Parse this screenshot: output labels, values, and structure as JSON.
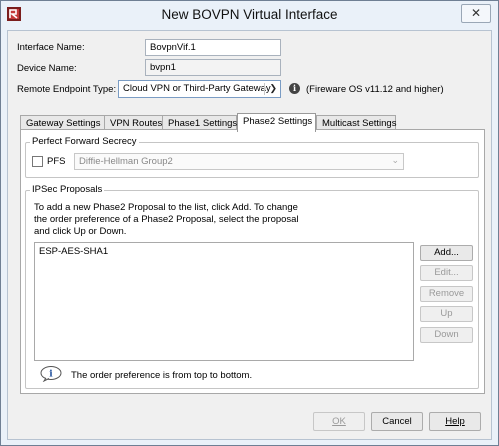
{
  "window": {
    "title": "New BOVPN Virtual Interface",
    "close_glyph": "✕"
  },
  "form": {
    "interface_name_label": "Interface Name:",
    "interface_name_value": "BovpnVif.1",
    "device_name_label": "Device Name:",
    "device_name_value": "bvpn1",
    "remote_endpoint_label": "Remote Endpoint Type:",
    "remote_endpoint_value": "Cloud VPN or Third-Party Gateway",
    "remote_endpoint_note": "(Fireware OS v11.12 and higher)"
  },
  "tabs": [
    {
      "label": "Gateway Settings"
    },
    {
      "label": "VPN Routes"
    },
    {
      "label": "Phase1 Settings"
    },
    {
      "label": "Phase2 Settings"
    },
    {
      "label": "Multicast Settings"
    }
  ],
  "pfs": {
    "group_label": "Perfect Forward Secrecy",
    "checkbox_label": "PFS",
    "checked": false,
    "dh_group_value": "Diffie-Hellman Group2"
  },
  "ipsec": {
    "group_label": "IPSec Proposals",
    "instructions_line1": "To add a new Phase2 Proposal to the list, click Add. To change",
    "instructions_line2": "the order preference of a Phase2 Proposal, select the proposal",
    "instructions_line3": "and click Up or Down.",
    "proposals": [
      "ESP-AES-SHA1"
    ],
    "buttons": {
      "add": "Add...",
      "edit": "Edit...",
      "remove": "Remove",
      "up": "Up",
      "down": "Down"
    },
    "note": "The order preference is from top to bottom."
  },
  "footer": {
    "ok": "OK",
    "cancel": "Cancel",
    "help": "Help"
  },
  "colors": {
    "window_bg": "#eaf1f9",
    "dialog_bg": "#f0f0f0",
    "panel_bg": "#ffffff",
    "disabled_text": "#9a9a9a"
  }
}
